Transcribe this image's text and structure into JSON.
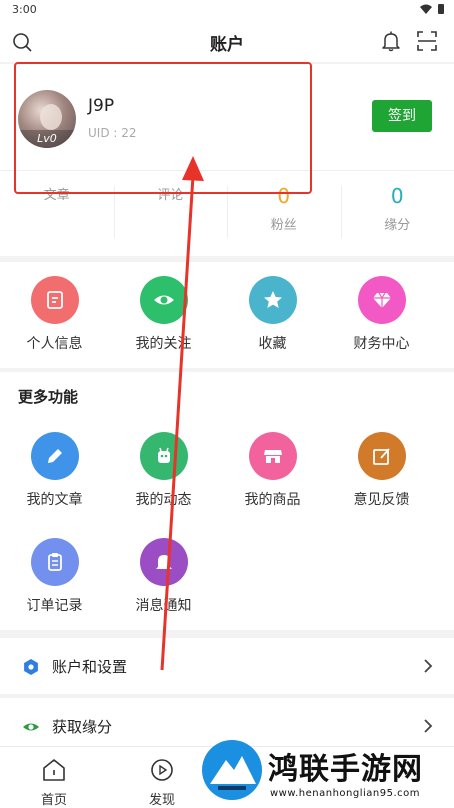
{
  "status": {
    "time": "3:00"
  },
  "header": {
    "title": "账户"
  },
  "profile": {
    "username": "J9P",
    "uid": "UID : 22",
    "level": "Lv0",
    "signin_label": "签到"
  },
  "stats": [
    {
      "value": "",
      "label": "文章",
      "color": "#f5a623"
    },
    {
      "value": "",
      "label": "评论",
      "color": "#f5a623"
    },
    {
      "value": "0",
      "label": "粉丝",
      "color": "#f5a623"
    },
    {
      "value": "0",
      "label": "缘分",
      "color": "#22aeb7"
    }
  ],
  "quick_actions": [
    {
      "label": "个人信息",
      "icon": "edit-icon",
      "color": "#f26d6d"
    },
    {
      "label": "我的关注",
      "icon": "eye-icon",
      "color": "#2dbf6b"
    },
    {
      "label": "收藏",
      "icon": "star-icon",
      "color": "#4ab4cd"
    },
    {
      "label": "财务中心",
      "icon": "diamond-icon",
      "color": "#f359c4"
    }
  ],
  "more": {
    "title": "更多功能",
    "items": [
      {
        "label": "我的文章",
        "icon": "pencil-icon",
        "color": "#3f93e8"
      },
      {
        "label": "我的动态",
        "icon": "dynamic-icon",
        "color": "#36b76f"
      },
      {
        "label": "我的商品",
        "icon": "store-icon",
        "color": "#f2639e"
      },
      {
        "label": "意见反馈",
        "icon": "feedback-icon",
        "color": "#d07a2a"
      },
      {
        "label": "订单记录",
        "icon": "clipboard-icon",
        "color": "#7390ee"
      },
      {
        "label": "消息通知",
        "icon": "bell-icon",
        "color": "#9b4ec3"
      }
    ]
  },
  "menu": [
    {
      "label": "账户和设置",
      "icon": "settings-icon",
      "color": "#2f7fe0"
    },
    {
      "label": "获取缘分",
      "icon": "eye-icon",
      "color": "#2a9b42"
    }
  ],
  "tabs": [
    {
      "label": "首页",
      "icon": "home-icon"
    },
    {
      "label": "发现",
      "icon": "play-icon"
    }
  ],
  "watermark": {
    "text": "鸿联手游网",
    "url": "www.henanhonglian95.com"
  },
  "colors": {
    "annotation": "#e8332a",
    "primary_green": "#1fa533"
  }
}
